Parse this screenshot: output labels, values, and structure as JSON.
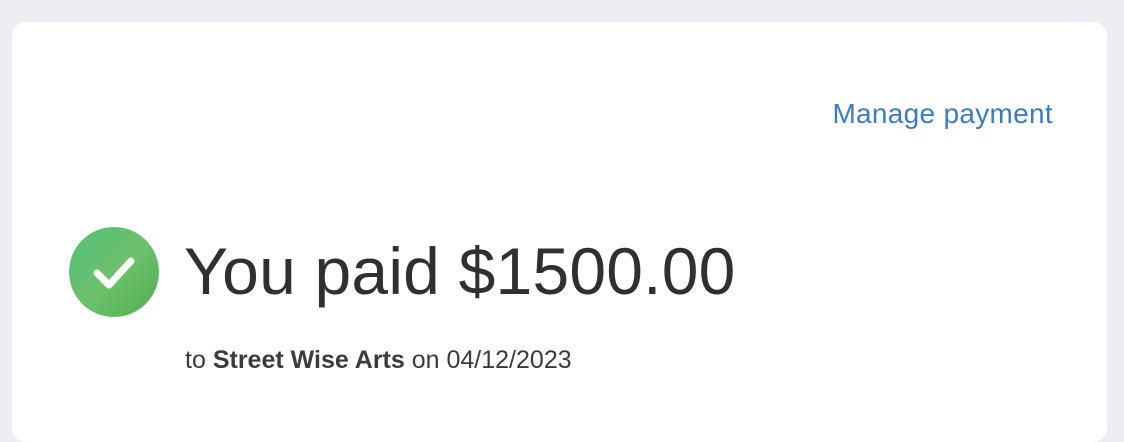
{
  "header": {
    "manage_link": "Manage payment"
  },
  "payment": {
    "status_icon": "check-circle-icon",
    "headline_prefix": "You paid",
    "amount": "$1500.00",
    "to_label": "to",
    "merchant": "Street Wise Arts",
    "on_label": "on",
    "date": "04/12/2023"
  },
  "colors": {
    "link": "#3d7bbf",
    "success": "#5cbf6e",
    "text": "#2f3033",
    "background": "#eceef1",
    "card": "#ffffff"
  }
}
